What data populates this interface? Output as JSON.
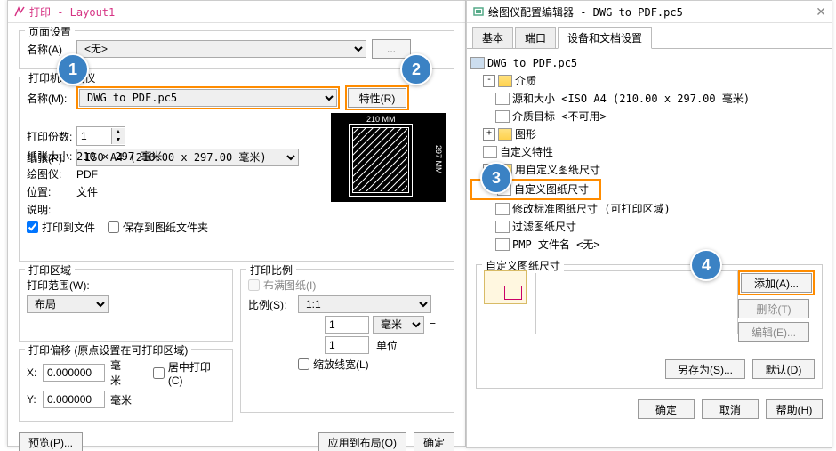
{
  "markers": {
    "m1": "1",
    "m2": "2",
    "m3": "3",
    "m4": "4"
  },
  "print": {
    "app_icon_color": "#d63384",
    "title": "打印 - Layout1",
    "page_setup": {
      "title": "页面设置",
      "name_lbl": "名称(A)",
      "name_val": "<无>",
      "dotdot_btn": "..."
    },
    "printer": {
      "title": "打印机/绘图仪",
      "name_lbl": "名称(M):",
      "name_val": "DWG to PDF.pc5",
      "props_btn": "特性(R)",
      "paper_lbl": "纸张(P):",
      "paper_val": "ISO A4 (210.00 x 297.00 毫米)",
      "copies_lbl": "打印份数:",
      "copies_val": "1",
      "size_lbl": "纸张大小:",
      "size_val": "210 × 297 毫米",
      "plotter_lbl": "绘图仪:",
      "plotter_val": "PDF",
      "pos_lbl": "位置:",
      "pos_val": "文件",
      "note_lbl": "说明:",
      "to_file": "打印到文件",
      "save_to_folder": "保存到图纸文件夹",
      "preview": {
        "w": "210 MM",
        "h": "297 MM"
      }
    },
    "area": {
      "title": "打印区域",
      "range_lbl": "打印范围(W):",
      "range_val": "布局"
    },
    "offset": {
      "title": "打印偏移 (原点设置在可打印区域)",
      "x_lbl": "X:",
      "x_val": "0.000000",
      "y_lbl": "Y:",
      "y_val": "0.000000",
      "unit": "毫米",
      "center": "居中打印(C)"
    },
    "scale": {
      "title": "打印比例",
      "fit": "布满图纸(I)",
      "scale_lbl": "比例(S):",
      "scale_val": "1:1",
      "num_val": "1",
      "unit_sel": "毫米",
      "eq": "=",
      "den_val": "1",
      "unit_txt": "单位",
      "lw": "缩放线宽(L)"
    },
    "bottom": {
      "preview": "预览(P)...",
      "apply": "应用到布局(O)",
      "ok": "确定"
    }
  },
  "plot": {
    "title": "绘图仪配置编辑器 - DWG to PDF.pc5",
    "tabs": {
      "basic": "基本",
      "port": "端口",
      "dev": "设备和文档设置"
    },
    "tree": {
      "root": "DWG to PDF.pc5",
      "media": "介质",
      "source_size": "源和大小 <ISO A4 (210.00 x 297.00 毫米)",
      "media_target": "介质目标 <不可用>",
      "graphics": "图形",
      "custom_props": "自定义特性",
      "user_paper": "用自定义图纸尺寸",
      "custom_size": "自定义图纸尺寸",
      "mod_std": "修改标准图纸尺寸 (可打印区域)",
      "filter": "过滤图纸尺寸",
      "pmp": "PMP 文件名 <无>"
    },
    "panel": {
      "title": "自定义图纸尺寸",
      "add": "添加(A)...",
      "del": "删除(T)",
      "edit": "编辑(E)..."
    },
    "save_as": "另存为(S)...",
    "default": "默认(D)",
    "ok": "确定",
    "cancel": "取消",
    "help": "帮助(H)"
  }
}
